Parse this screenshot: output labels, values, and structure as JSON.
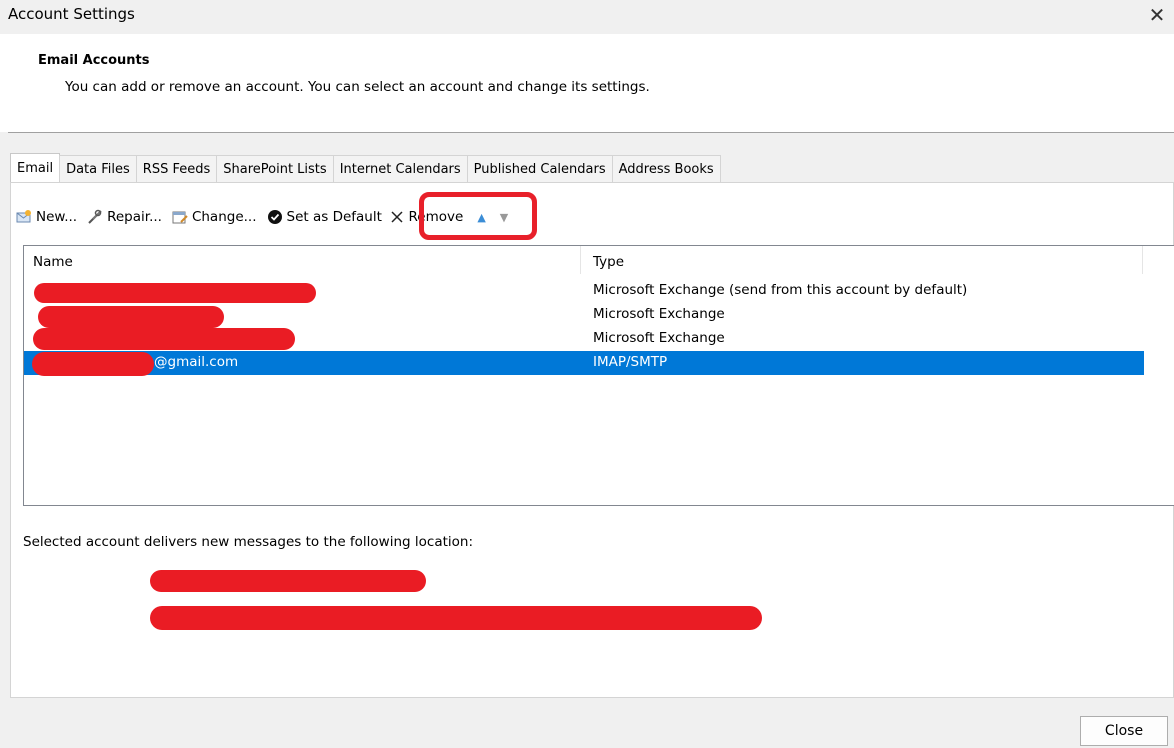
{
  "window": {
    "title": "Account Settings"
  },
  "header": {
    "title": "Email Accounts",
    "description": "You can add or remove an account. You can select an account and change its settings."
  },
  "tabs": [
    {
      "label": "Email",
      "active": true
    },
    {
      "label": "Data Files"
    },
    {
      "label": "RSS Feeds"
    },
    {
      "label": "SharePoint Lists"
    },
    {
      "label": "Internet Calendars"
    },
    {
      "label": "Published Calendars"
    },
    {
      "label": "Address Books"
    }
  ],
  "toolbar": {
    "new": "New...",
    "repair": "Repair...",
    "change": "Change...",
    "set_default": "Set as Default",
    "remove": "Remove"
  },
  "list": {
    "columns": {
      "name": "Name",
      "type": "Type"
    },
    "rows": [
      {
        "name": "",
        "type": "Microsoft Exchange (send from this account by default)",
        "selected": false
      },
      {
        "name": "",
        "type": "Microsoft Exchange",
        "selected": false
      },
      {
        "name": "",
        "type": "Microsoft Exchange",
        "selected": false
      },
      {
        "name": "@gmail.com",
        "type": "IMAP/SMTP",
        "selected": true
      }
    ]
  },
  "location": {
    "label": "Selected account delivers new messages to the following location:"
  },
  "footer": {
    "close": "Close"
  },
  "colors": {
    "selection": "#0078d7",
    "annotation": "#ea1c24"
  }
}
